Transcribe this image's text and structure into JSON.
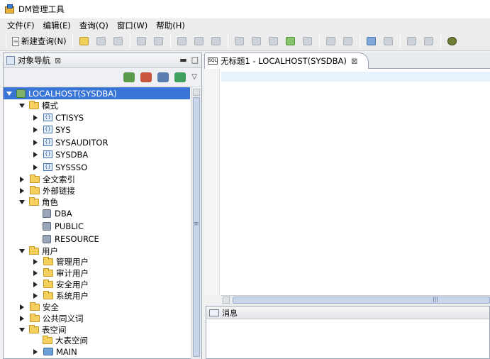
{
  "window": {
    "title": "DM管理工具"
  },
  "menu": [
    "文件(F)",
    "编辑(E)",
    "查询(Q)",
    "窗口(W)",
    "帮助(H)"
  ],
  "toolbar": {
    "new_query_label": "新建查询(N)"
  },
  "navigator": {
    "title": "对象导航",
    "close_glyph": "⊠",
    "tree": [
      {
        "label": "LOCALHOST(SYSDBA)",
        "level": 0,
        "expander": "open",
        "icon": "server-icon",
        "selected": true
      },
      {
        "label": "模式",
        "level": 1,
        "expander": "open",
        "icon": "folder-icon"
      },
      {
        "label": "CTISYS",
        "level": 2,
        "expander": "closed",
        "icon": "schema-icon"
      },
      {
        "label": "SYS",
        "level": 2,
        "expander": "closed",
        "icon": "schema-icon"
      },
      {
        "label": "SYSAUDITOR",
        "level": 2,
        "expander": "closed",
        "icon": "schema-icon"
      },
      {
        "label": "SYSDBA",
        "level": 2,
        "expander": "closed",
        "icon": "schema-icon"
      },
      {
        "label": "SYSSSO",
        "level": 2,
        "expander": "closed",
        "icon": "schema-icon"
      },
      {
        "label": "全文索引",
        "level": 1,
        "expander": "closed",
        "icon": "folder-icon"
      },
      {
        "label": "外部链接",
        "level": 1,
        "expander": "closed",
        "icon": "folder-icon"
      },
      {
        "label": "角色",
        "level": 1,
        "expander": "open",
        "icon": "folder-icon"
      },
      {
        "label": "DBA",
        "level": 2,
        "expander": "none",
        "icon": "role-icon"
      },
      {
        "label": "PUBLIC",
        "level": 2,
        "expander": "none",
        "icon": "role-icon"
      },
      {
        "label": "RESOURCE",
        "level": 2,
        "expander": "none",
        "icon": "role-icon"
      },
      {
        "label": "用户",
        "level": 1,
        "expander": "open",
        "icon": "folder-icon"
      },
      {
        "label": "管理用户",
        "level": 2,
        "expander": "closed",
        "icon": "folder-icon"
      },
      {
        "label": "审计用户",
        "level": 2,
        "expander": "closed",
        "icon": "folder-icon"
      },
      {
        "label": "安全用户",
        "level": 2,
        "expander": "closed",
        "icon": "folder-icon"
      },
      {
        "label": "系统用户",
        "level": 2,
        "expander": "closed",
        "icon": "folder-icon"
      },
      {
        "label": "安全",
        "level": 1,
        "expander": "closed",
        "icon": "folder-icon"
      },
      {
        "label": "公共同义词",
        "level": 1,
        "expander": "closed",
        "icon": "folder-icon"
      },
      {
        "label": "表空间",
        "level": 1,
        "expander": "open",
        "icon": "folder-icon"
      },
      {
        "label": "大表空间",
        "level": 2,
        "expander": "none",
        "icon": "folder-icon"
      },
      {
        "label": "MAIN",
        "level": 2,
        "expander": "closed",
        "icon": "tablespace-icon"
      }
    ]
  },
  "editor": {
    "tab_label": "无标题1 - LOCALHOST(SYSDBA)",
    "tab_close_glyph": "⊠",
    "sql_icon_text": "SQL"
  },
  "messages": {
    "title": "消息"
  },
  "scroll": {
    "v_grip": "≡",
    "h_grip": "|||"
  }
}
